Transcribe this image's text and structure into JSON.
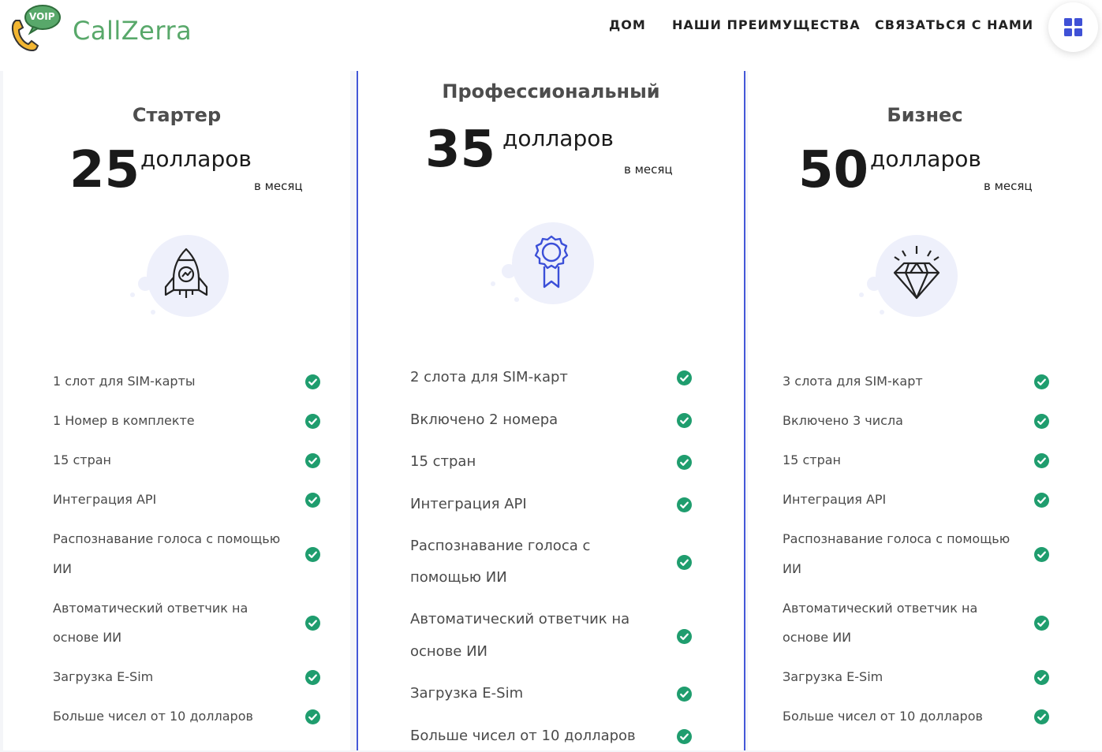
{
  "header": {
    "logo_badge": "VOIP",
    "logo_text": "CallZerra",
    "nav": [
      "ДОМ",
      "НАШИ ПРЕИМУЩЕСТВА",
      "СВЯЗАТЬСЯ С НАМИ"
    ],
    "menu_icon": "grid-icon"
  },
  "colors": {
    "accent": "#4458d8",
    "check": "#1f9d6e",
    "logo": "#58a86a",
    "icon_bg": "#eef0fb"
  },
  "plans": [
    {
      "name": "Стартер",
      "price": "25",
      "currency": "долларов",
      "period": "в месяц",
      "icon": "rocket-icon",
      "features": [
        "1 слот для SIM-карты",
        "1 Номер в комплекте",
        "15 стран",
        "Интеграция API",
        "Распознавание голоса с помощью",
        "ИИ",
        "Автоматический ответчик на",
        "основе ИИ",
        "Загрузка E-Sim",
        "Больше чисел от 10 долларов"
      ]
    },
    {
      "name": "Профессиональный",
      "price": "35",
      "currency": "долларов",
      "period": "в месяц",
      "icon": "award-ribbon-icon",
      "features": [
        "2 слота для SIM-карт",
        "Включено 2 номера",
        "15 стран",
        "Интеграция API",
        "Распознавание голоса с",
        "помощью ИИ",
        "Автоматический ответчик на",
        "основе ИИ",
        "Загрузка E-Sim",
        "Больше чисел от 10 долларов"
      ]
    },
    {
      "name": "Бизнес",
      "price": "50",
      "currency": "долларов",
      "period": "в месяц",
      "icon": "diamond-icon",
      "features": [
        "3 слота для SIM-карт",
        "Включено 3 числа",
        "15 стран",
        "Интеграция API",
        "Распознавание голоса с помощью",
        "ИИ",
        "Автоматический ответчик на",
        "основе ИИ",
        "Загрузка E-Sim",
        "Больше чисел от 10 долларов"
      ]
    }
  ]
}
